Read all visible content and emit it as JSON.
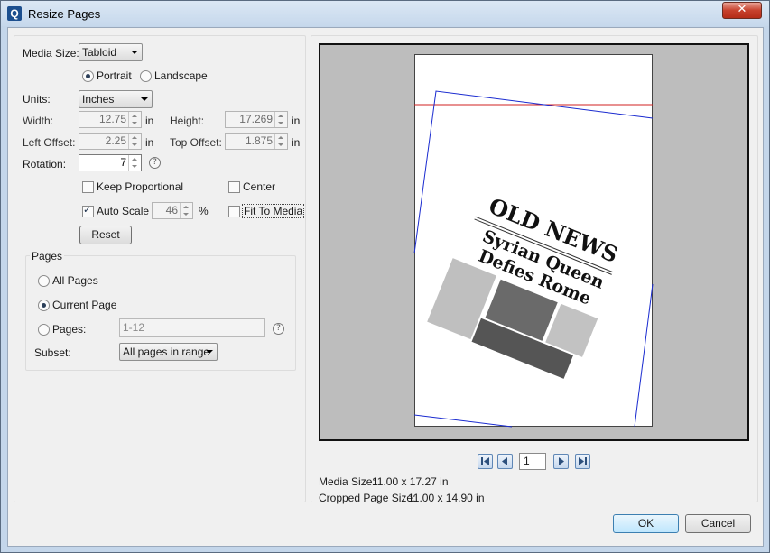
{
  "window": {
    "title": "Resize Pages",
    "close_label": "✕",
    "app_icon_letter": "Q"
  },
  "media": {
    "label": "Media Size:",
    "value": "Tabloid"
  },
  "orientation": {
    "portrait": "Portrait",
    "landscape": "Landscape",
    "selected": "Portrait"
  },
  "units": {
    "label": "Units:",
    "value": "Inches"
  },
  "width": {
    "label": "Width:",
    "value": "12.75",
    "unit": "in"
  },
  "height": {
    "label": "Height:",
    "value": "17.269",
    "unit": "in"
  },
  "left_offset": {
    "label": "Left Offset:",
    "value": "2.25",
    "unit": "in"
  },
  "top_offset": {
    "label": "Top Offset:",
    "value": "1.875",
    "unit": "in"
  },
  "rotation": {
    "label": "Rotation:",
    "value": "7",
    "help": "?"
  },
  "options": {
    "keep_proportional": "Keep Proportional",
    "center": "Center",
    "auto_scale": "Auto Scale",
    "auto_scale_value": "46",
    "percent": "%",
    "fit_to_media": "Fit To Media",
    "reset": "Reset"
  },
  "pages": {
    "group_label": "Pages",
    "all_pages": "All Pages",
    "current_page": "Current Page",
    "pages_label": "Pages:",
    "pages_placeholder": "1-12",
    "help": "?",
    "subset_label": "Subset:",
    "subset_value": "All pages in range"
  },
  "preview": {
    "newspaper_title": "OLD NEWS",
    "headline_1": "Syrian Queen",
    "headline_2": "Defies Rome",
    "page_number": "1",
    "media_size_label": "Media Size:",
    "media_size_value": "11.00 x 17.27 in",
    "cropped_label": "Cropped Page Size:",
    "cropped_value": "11.00 x 14.90 in"
  },
  "footer": {
    "ok": "OK",
    "cancel": "Cancel"
  }
}
